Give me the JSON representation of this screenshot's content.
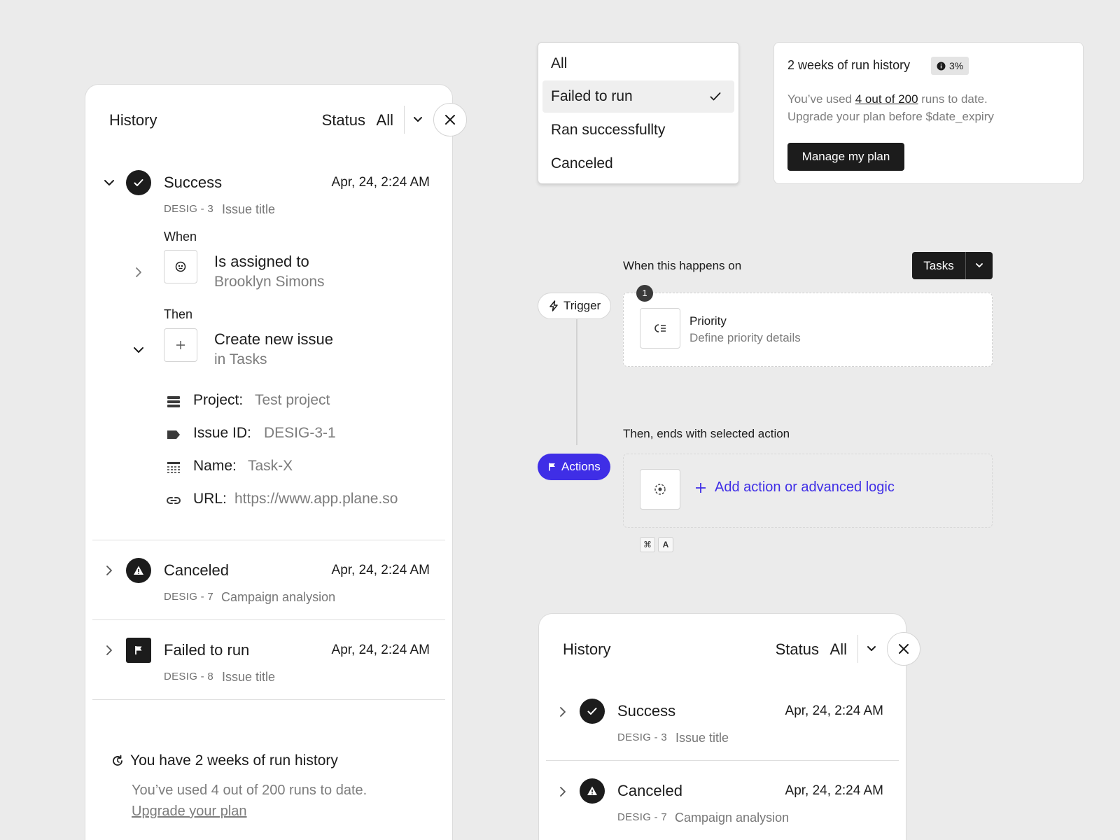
{
  "history_left": {
    "title": "History",
    "status_label": "Status",
    "status_value": "All",
    "rows": [
      {
        "status": "Success",
        "date": "Apr, 24, 2:24 AM",
        "id": "DESIG - 3",
        "subtitle": "Issue title",
        "expanded": true
      },
      {
        "status": "Canceled",
        "date": "Apr, 24, 2:24 AM",
        "id": "DESIG - 7",
        "subtitle": "Campaign analysion",
        "expanded": false
      },
      {
        "status": "Failed to run",
        "date": "Apr, 24, 2:24 AM",
        "id": "DESIG - 8",
        "subtitle": "Issue title",
        "expanded": false
      }
    ],
    "details": {
      "when_label": "When",
      "when_main": "Is assigned to",
      "when_sub": "Brooklyn Simons",
      "then_label": "Then",
      "then_main": "Create new issue",
      "then_sub": "in Tasks",
      "fields": [
        {
          "label": "Project:",
          "value": "Test project",
          "icon": "project-icon"
        },
        {
          "label": "Issue ID:",
          "value": "DESIG-3-1",
          "icon": "tag-icon"
        },
        {
          "label": "Name:",
          "value": "Task-X",
          "icon": "name-icon"
        },
        {
          "label": "URL:",
          "value": "https://www.app.plane.so",
          "icon": "link-icon"
        }
      ]
    },
    "footer": {
      "title": "You have 2 weeks of run history",
      "text": "You’ve used 4 out of 200 runs to date.",
      "link": "Upgrade your plan"
    }
  },
  "status_dropdown": {
    "options": [
      "All",
      "Failed to run",
      "Ran successfullty",
      "Canceled"
    ],
    "selected": "Failed to run"
  },
  "usage_card": {
    "title": "2 weeks of run history",
    "badge": "3%",
    "line1_prefix": "You’ve used ",
    "line1_link": "4 out of 200",
    "line1_suffix": " runs to date.",
    "line2": "Upgrade your plan before $date_expiry",
    "button": "Manage my plan"
  },
  "builder": {
    "when_heading": "When this happens on",
    "scope_button": "Tasks",
    "trigger_pill": "Trigger",
    "trigger_badge": "1",
    "trigger_title": "Priority",
    "trigger_sub": "Define priority details",
    "then_heading": "Then, ends with selected action",
    "actions_pill": "Actions",
    "add_action": "Add action or advanced logic",
    "shortcut_keys": [
      "⌘",
      "A"
    ],
    "accent": "#3f2ee6"
  },
  "history_right": {
    "title": "History",
    "status_label": "Status",
    "status_value": "All",
    "rows": [
      {
        "status": "Success",
        "date": "Apr, 24, 2:24 AM",
        "id": "DESIG - 3",
        "subtitle": "Issue title"
      },
      {
        "status": "Canceled",
        "date": "Apr, 24, 2:24 AM",
        "id": "DESIG - 7",
        "subtitle": "Campaign analysion"
      }
    ]
  }
}
